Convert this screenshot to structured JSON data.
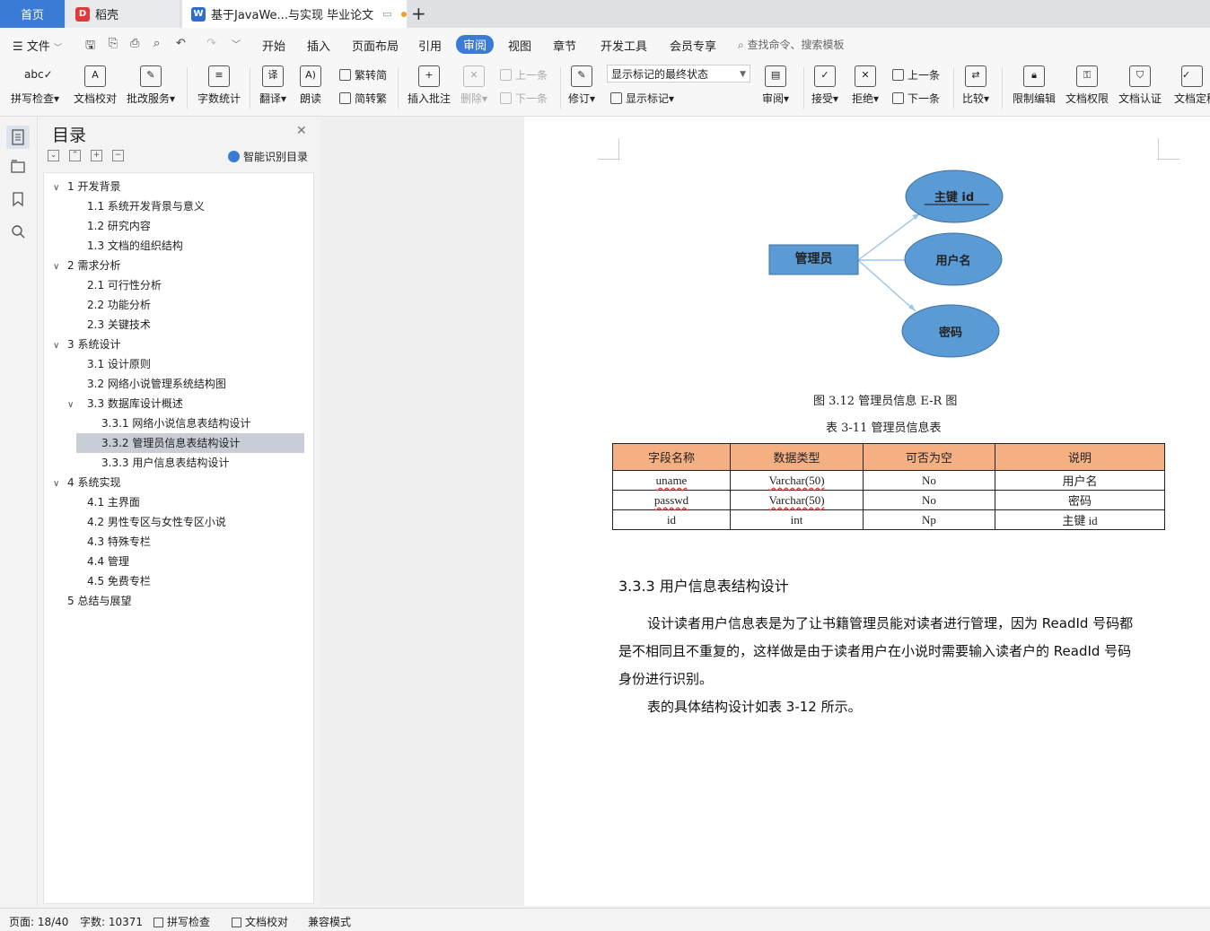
{
  "tabs": {
    "home": "首页",
    "daoke": "稻壳",
    "document": "基于JavaWe...与实现 毕业论文"
  },
  "menu": {
    "file": "文件",
    "items": [
      "开始",
      "插入",
      "页面布局",
      "引用",
      "审阅",
      "视图",
      "章节",
      "开发工具",
      "会员专享"
    ],
    "search_placeholder": "查找命令、搜索模板"
  },
  "ribbon": {
    "spellcheck": "拼写检查",
    "doc_proof": "文档校对",
    "batch_service": "批改服务",
    "word_count": "字数统计",
    "translate": "翻译",
    "read_aloud": "朗读",
    "trad_to_simp": "繁转简",
    "simp_to_trad": "简转繁",
    "insert_comment": "插入批注",
    "delete": "删除",
    "prev_comment": "上一条",
    "next_comment": "下一条",
    "track_changes": "修订",
    "markup_state": "显示标记的最终状态",
    "show_markup": "显示标记",
    "review": "审阅",
    "accept": "接受",
    "reject": "拒绝",
    "prev_change": "上一条",
    "next_change": "下一条",
    "compare": "比较",
    "restrict_edit": "限制编辑",
    "doc_permission": "文档权限",
    "doc_certify": "文档认证",
    "doc_final": "文档定稿"
  },
  "toc": {
    "title": "目录",
    "smart_toc": "智能识别目录",
    "items": [
      {
        "label": "1  开发背景",
        "level": 1,
        "expanded": true
      },
      {
        "label": "1.1  系统开发背景与意义",
        "level": 2
      },
      {
        "label": "1.2  研究内容",
        "level": 2
      },
      {
        "label": "1.3  文档的组织结构",
        "level": 2
      },
      {
        "label": "2  需求分析",
        "level": 1,
        "expanded": true
      },
      {
        "label": "2.1  可行性分析",
        "level": 2
      },
      {
        "label": "2.2  功能分析",
        "level": 2
      },
      {
        "label": "2.3  关键技术",
        "level": 2
      },
      {
        "label": "3  系统设计",
        "level": 1,
        "expanded": true
      },
      {
        "label": "3.1  设计原则",
        "level": 2
      },
      {
        "label": "3.2  网络小说管理系统结构图",
        "level": 2
      },
      {
        "label": "3.3  数据库设计概述",
        "level": 2,
        "expanded": true
      },
      {
        "label": "3.3.1  网络小说信息表结构设计",
        "level": 3
      },
      {
        "label": "3.3.2  管理员信息表结构设计",
        "level": 3,
        "selected": true
      },
      {
        "label": "3.3.3  用户信息表结构设计",
        "level": 3
      },
      {
        "label": "4  系统实现",
        "level": 1,
        "expanded": true
      },
      {
        "label": "4.1  主界面",
        "level": 2
      },
      {
        "label": "4.2  男性专区与女性专区小说",
        "level": 2
      },
      {
        "label": "4.3  特殊专栏",
        "level": 2
      },
      {
        "label": "4.4  管理",
        "level": 2
      },
      {
        "label": "4.5  免费专栏",
        "level": 2
      },
      {
        "label": "5  总结与展望",
        "level": 1
      }
    ]
  },
  "document": {
    "er": {
      "entity": "管理员",
      "attr_key": "主键 id",
      "attr_user": "用户名",
      "attr_pass": "密码",
      "colors": {
        "fill": "#5b9bd5",
        "stroke": "#41719c",
        "line": "#9dc3e6"
      }
    },
    "figure_caption": "图 3.12  管理员信息 E-R 图",
    "table_caption": "表 3-11  管理员信息表",
    "table": {
      "headers": [
        "字段名称",
        "数据类型",
        "可否为空",
        "说明"
      ],
      "rows": [
        [
          "uname",
          "Varchar(50)",
          "No",
          "用户名"
        ],
        [
          "passwd",
          "Varchar(50)",
          "No",
          "密码"
        ],
        [
          "id",
          "int",
          "Np",
          "主键 id"
        ]
      ],
      "header_color": "#f4b083"
    },
    "section_heading": "3.3.3  用户信息表结构设计",
    "paragraphs": {
      "p1_line1": "设计读者用户信息表是为了让书籍管理员能对读者进行管理，因为 ReadId 号码都",
      "p1_line2": "是不相同且不重复的，这样做是由于读者用户在小说时需要输入读者户的 ReadId 号码",
      "p1_line3": "身份进行识别。",
      "p2": "表的具体结构设计如表 3-12 所示。"
    }
  },
  "status": {
    "page": "页面: 18/40",
    "words": "字数: 10371",
    "spellcheck": "拼写检查",
    "proof": "文档校对",
    "compat": "兼容模式"
  },
  "colors": {
    "accent": "#3a7bd5"
  }
}
